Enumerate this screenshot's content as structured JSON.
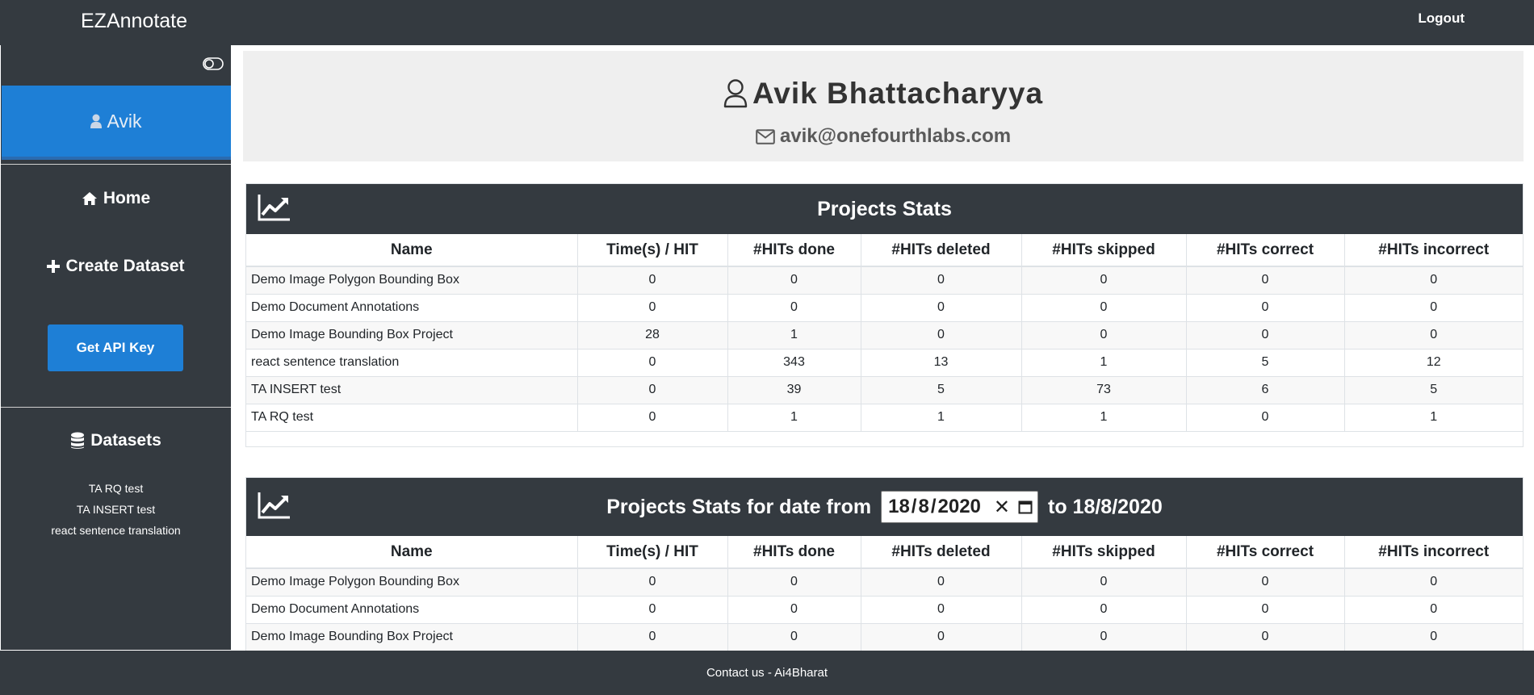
{
  "app": {
    "title": "EZAnnotate"
  },
  "header": {
    "logout_label": "Logout"
  },
  "sidebar": {
    "user_name": "Avik",
    "nav": {
      "home": "Home",
      "create_dataset": "Create Dataset"
    },
    "api_button": "Get API Key",
    "datasets_title": "Datasets",
    "datasets": [
      "TA RQ test",
      "TA INSERT test",
      "react sentence translation"
    ]
  },
  "profile": {
    "name": "Avik Bhattacharyya",
    "email": "avik@onefourthlabs.com"
  },
  "stats": {
    "title": "Projects Stats",
    "columns": [
      "Name",
      "Time(s) / HIT",
      "#HITs done",
      "#HITs deleted",
      "#HITs skipped",
      "#HITs correct",
      "#HITs incorrect"
    ],
    "rows": [
      [
        "Demo Image Polygon Bounding Box",
        "0",
        "0",
        "0",
        "0",
        "0",
        "0"
      ],
      [
        "Demo Document Annotations",
        "0",
        "0",
        "0",
        "0",
        "0",
        "0"
      ],
      [
        "Demo Image Bounding Box Project",
        "28",
        "1",
        "0",
        "0",
        "0",
        "0"
      ],
      [
        "react sentence translation",
        "0",
        "343",
        "13",
        "1",
        "5",
        "12"
      ],
      [
        "TA INSERT test",
        "0",
        "39",
        "5",
        "73",
        "6",
        "5"
      ],
      [
        "TA RQ test",
        "0",
        "1",
        "1",
        "1",
        "0",
        "1"
      ]
    ]
  },
  "date_stats": {
    "title_prefix": "Projects Stats for date from",
    "date_from": {
      "day": "18",
      "month": "8",
      "year": "2020"
    },
    "title_suffix": "to 18/8/2020",
    "columns": [
      "Name",
      "Time(s) / HIT",
      "#HITs done",
      "#HITs deleted",
      "#HITs skipped",
      "#HITs correct",
      "#HITs incorrect"
    ],
    "rows": [
      [
        "Demo Image Polygon Bounding Box",
        "0",
        "0",
        "0",
        "0",
        "0",
        "0"
      ],
      [
        "Demo Document Annotations",
        "0",
        "0",
        "0",
        "0",
        "0",
        "0"
      ],
      [
        "Demo Image Bounding Box Project",
        "0",
        "0",
        "0",
        "0",
        "0",
        "0"
      ]
    ]
  },
  "footer": {
    "text": "Contact us - Ai4Bharat"
  },
  "colors": {
    "navbar": "#343a40",
    "accent": "#1e7fd6",
    "profile_bg": "#efefef"
  }
}
